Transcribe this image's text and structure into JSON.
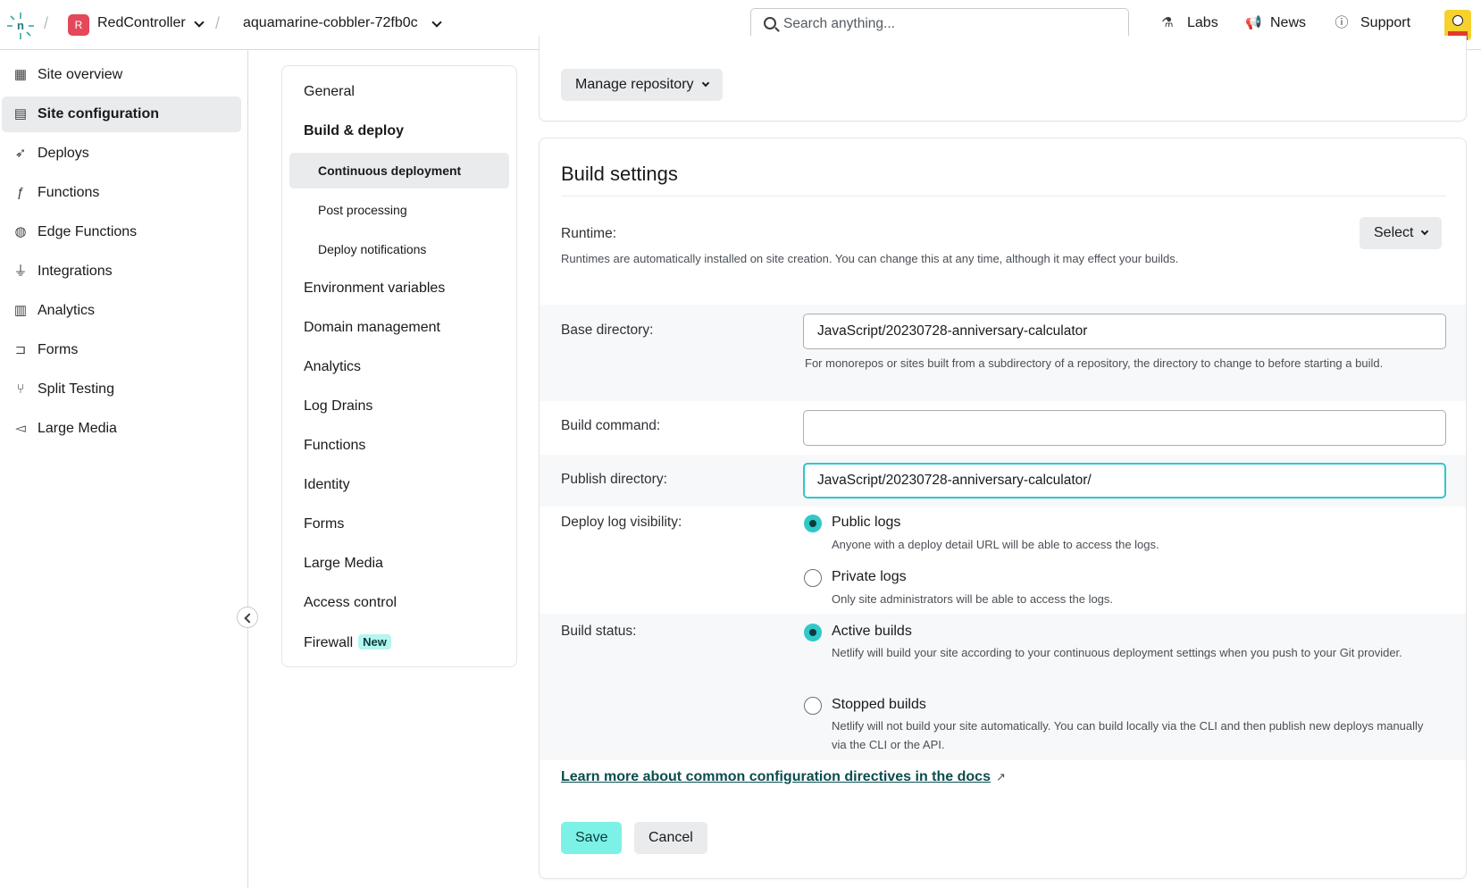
{
  "header": {
    "team_initial": "R",
    "team_name": "RedController",
    "site_name": "aquamarine-cobbler-72fb0c",
    "search_placeholder": "Search anything...",
    "nav": [
      {
        "label": "Labs",
        "icon": "flask-icon"
      },
      {
        "label": "News",
        "icon": "megaphone-icon"
      },
      {
        "label": "Support",
        "icon": "help-circle-icon"
      }
    ]
  },
  "sidebar": {
    "items": [
      {
        "label": "Site overview",
        "icon": "grid-icon"
      },
      {
        "label": "Site configuration",
        "icon": "config-icon",
        "active": true
      },
      {
        "label": "Deploys",
        "icon": "rocket-icon"
      },
      {
        "label": "Functions",
        "icon": "function-icon"
      },
      {
        "label": "Edge Functions",
        "icon": "globe-icon"
      },
      {
        "label": "Integrations",
        "icon": "plug-icon"
      },
      {
        "label": "Analytics",
        "icon": "bar-chart-icon"
      },
      {
        "label": "Forms",
        "icon": "form-icon"
      },
      {
        "label": "Split Testing",
        "icon": "split-icon"
      },
      {
        "label": "Large Media",
        "icon": "media-icon"
      }
    ]
  },
  "subnav": {
    "items": [
      {
        "label": "General"
      },
      {
        "label": "Build & deploy"
      },
      {
        "label": "Continuous deployment"
      },
      {
        "label": "Post processing"
      },
      {
        "label": "Deploy notifications"
      },
      {
        "label": "Environment variables"
      },
      {
        "label": "Domain management"
      },
      {
        "label": "Analytics"
      },
      {
        "label": "Log Drains"
      },
      {
        "label": "Functions"
      },
      {
        "label": "Identity"
      },
      {
        "label": "Forms"
      },
      {
        "label": "Large Media"
      },
      {
        "label": "Access control"
      },
      {
        "label": "Firewall"
      }
    ],
    "new_badge": "New"
  },
  "repository": {
    "manage_label": "Manage repository"
  },
  "build_settings": {
    "title": "Build settings",
    "runtime": {
      "label": "Runtime:",
      "select_label": "Select",
      "help": "Runtimes are automatically installed on site creation. You can change this at any time, although it may effect your builds."
    },
    "base_directory": {
      "label": "Base directory:",
      "value": "JavaScript/20230728-anniversary-calculator",
      "help": "For monorepos or sites built from a subdirectory of a repository, the directory to change to before starting a build."
    },
    "build_command": {
      "label": "Build command:",
      "value": ""
    },
    "publish_directory": {
      "label": "Publish directory:",
      "value": "JavaScript/20230728-anniversary-calculator/"
    },
    "deploy_log_visibility": {
      "label": "Deploy log visibility:",
      "options": [
        {
          "label": "Public logs",
          "help": "Anyone with a deploy detail URL will be able to access the logs.",
          "checked": true
        },
        {
          "label": "Private logs",
          "help": "Only site administrators will be able to access the logs.",
          "checked": false
        }
      ]
    },
    "build_status": {
      "label": "Build status:",
      "options": [
        {
          "label": "Active builds",
          "help": "Netlify will build your site according to your continuous deployment settings when you push to your Git provider.",
          "checked": true
        },
        {
          "label": "Stopped builds",
          "help": "Netlify will not build your site automatically. You can build locally via the CLI and then publish new deploys manually via the CLI or the API.",
          "checked": false
        }
      ]
    },
    "docs_link": "Learn more about common configuration directives in the docs",
    "save_label": "Save",
    "cancel_label": "Cancel"
  },
  "colors": {
    "accent": "#30c8c9",
    "save_button": "#7cf2e6",
    "team_badge": "#e3495a",
    "link": "#0a4d4e"
  }
}
